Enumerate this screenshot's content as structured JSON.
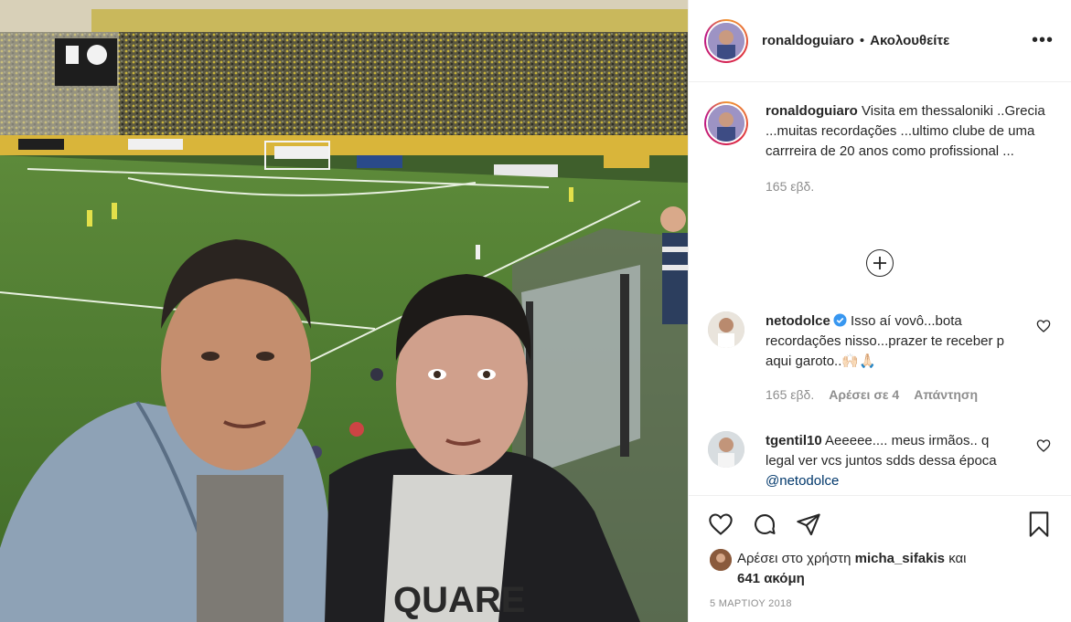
{
  "header": {
    "username": "ronaldoguiaro",
    "separator": "•",
    "follow_status": "Ακολουθείτε",
    "more_label": "•••"
  },
  "caption": {
    "username": "ronaldoguiaro",
    "text": "Visita em thessaloniki ..Grecia ...muitas recordações ...ultimo clube de uma carrreira de 20 anos como profissional ...",
    "time": "165 εβδ."
  },
  "comments": [
    {
      "username": "netodolce",
      "verified": true,
      "text": "Isso aí vovô...bota recordações nisso...prazer te receber p aqui garoto..🙌🏻🙏🏻",
      "time": "165 εβδ.",
      "likes": "Αρέσει σε 4",
      "reply": "Απάντηση"
    },
    {
      "username": "tgentil10",
      "verified": false,
      "text": "Aeeeee.... meus irmãos.. q legal ver vcs juntos sdds dessa época",
      "mention": "@netodolce"
    }
  ],
  "likes": {
    "prefix": "Αρέσει στο χρήστη",
    "user": "micha_sifakis",
    "conjunction": "και",
    "count": "641 ακόμη"
  },
  "date": "5 ΜΑΡΤΙΟΥ 2018",
  "icons": [
    "more-icon",
    "add-circle-icon",
    "verified-icon",
    "heart-icon",
    "comment-icon",
    "share-icon",
    "bookmark-icon"
  ],
  "colors": {
    "text": "#262626",
    "muted": "#8e8e8e",
    "link": "#00376b",
    "verified": "#3897f0",
    "border": "#efefef"
  }
}
